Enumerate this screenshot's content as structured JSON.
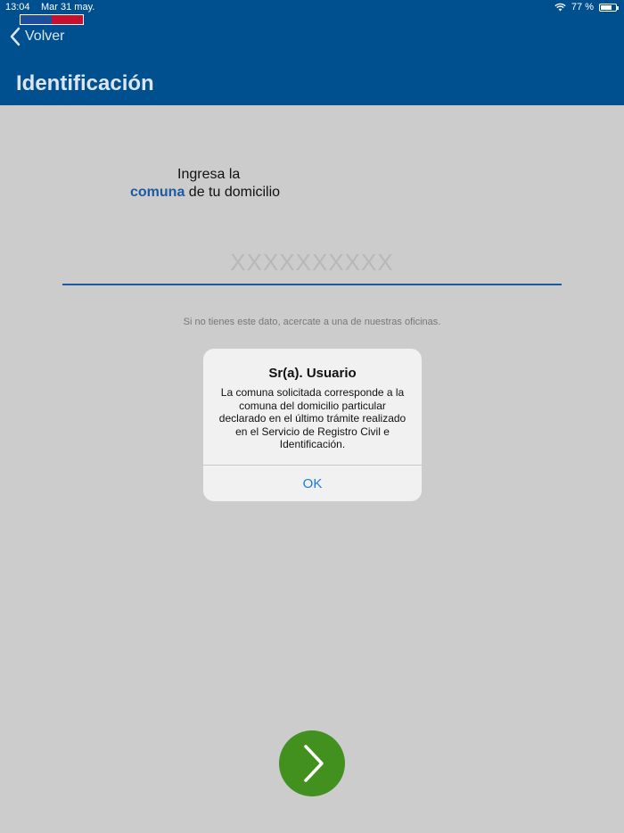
{
  "status_bar": {
    "time": "13:04",
    "date": "Mar 31 may.",
    "battery": "77 %",
    "battery_level": 0.77,
    "icons": [
      "wifi-icon",
      "battery-icon"
    ]
  },
  "header": {
    "back_label": "Volver",
    "back_icon": "chevron-left-icon",
    "title": "Identificación",
    "background_color": "#00508f"
  },
  "form": {
    "prompt_line1": "Ingresa la",
    "prompt_highlight": "comuna",
    "prompt_rest": " de tu domicilio",
    "input_value": "",
    "input_placeholder": "XXXXXXXXXX",
    "hint": "Si no tienes este dato, acercate a una de nuestras oficinas."
  },
  "alert": {
    "title": "Sr(a). Usuario",
    "message": "La comuna solicitada corresponde a la comuna del domicilio particular declarado en el último trámite realizado en el Servicio de Registro Civil e Identificación.",
    "ok_label": "OK"
  },
  "next_button": {
    "icon": "chevron-right-icon",
    "color": "#42911f"
  }
}
